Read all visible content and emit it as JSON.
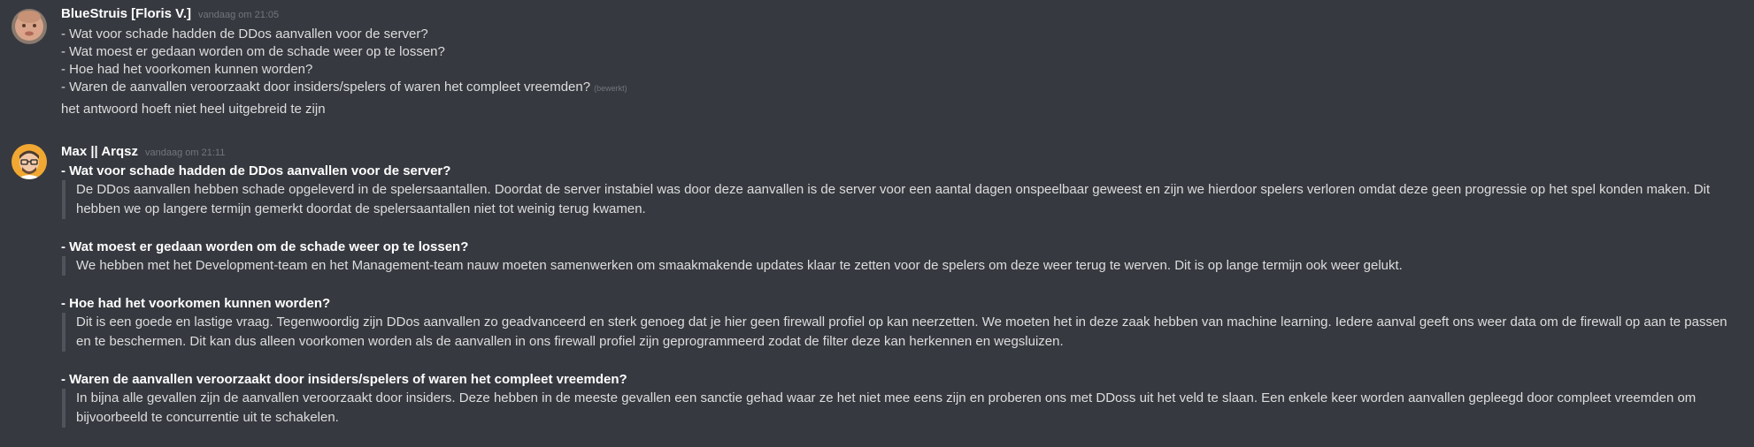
{
  "messages": [
    {
      "author": "BlueStruis [Floris V.]",
      "timestamp": "vandaag om 21:05",
      "lines": [
        "- Wat voor schade hadden de DDos aanvallen voor de server?",
        "- Wat moest er gedaan worden om de schade weer op te lossen?",
        "- Hoe had het voorkomen kunnen worden?",
        "- Waren de aanvallen veroorzaakt door insiders/spelers of waren het compleet vreemden?"
      ],
      "edited_label": "(bewerkt)",
      "followup": "het antwoord hoeft niet heel uitgebreid te zijn"
    },
    {
      "author": "Max || Arqsz",
      "timestamp": "vandaag om 21:11",
      "qa": [
        {
          "question": "- Wat voor schade hadden de DDos aanvallen voor de server?",
          "answer": "De DDos aanvallen hebben schade opgeleverd in de spelersaantallen. Doordat de server instabiel was door deze aanvallen is de server voor een aantal dagen onspeelbaar geweest en zijn we hierdoor spelers verloren omdat deze geen progressie op het spel konden maken. Dit hebben we op langere termijn gemerkt doordat de spelersaantallen niet tot weinig terug kwamen."
        },
        {
          "question": "- Wat moest er gedaan worden om de schade weer op te lossen?",
          "answer": "We hebben met het Development-team en het Management-team nauw moeten samenwerken om smaakmakende updates klaar te zetten voor de spelers om deze weer terug te werven. Dit is op lange termijn ook weer gelukt."
        },
        {
          "question": "- Hoe had het voorkomen kunnen worden?",
          "answer": "Dit is een goede en lastige vraag. Tegenwoordig zijn DDos aanvallen zo geadvanceerd en sterk genoeg dat je hier geen firewall profiel op kan neerzetten. We moeten het in deze zaak hebben van machine learning. Iedere aanval geeft ons weer data om de firewall op aan te passen en te beschermen. Dit kan dus alleen voorkomen worden als de aanvallen in ons firewall profiel zijn geprogrammeerd zodat de filter deze kan herkennen en wegsluizen."
        },
        {
          "question": "- Waren de aanvallen veroorzaakt door insiders/spelers of waren het compleet vreemden?",
          "answer": "In bijna alle gevallen zijn de aanvallen veroorzaakt door insiders. Deze hebben in de meeste gevallen een sanctie gehad waar ze het niet mee eens zijn en proberen ons met DDoss uit het veld te slaan. Een enkele keer worden aanvallen gepleegd door compleet vreemden om bijvoorbeeld te concurrentie uit te schakelen."
        }
      ]
    }
  ],
  "colors": {
    "background": "#36393f",
    "username": "#ffffff",
    "timestamp": "#72767d",
    "text": "#dcddde",
    "quote_bar": "#4f545c"
  }
}
